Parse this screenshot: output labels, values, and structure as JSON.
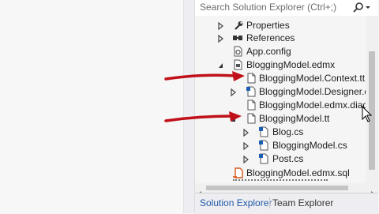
{
  "search": {
    "placeholder": "Search Solution Explorer (Ctrl+;)"
  },
  "tree": {
    "items": [
      {
        "label": "Properties"
      },
      {
        "label": "References"
      },
      {
        "label": "App.config"
      },
      {
        "label": "BloggingModel.edmx"
      },
      {
        "label": "BloggingModel.Context.tt"
      },
      {
        "label": "BloggingModel.Designer.cs"
      },
      {
        "label": "BloggingModel.edmx.diagram"
      },
      {
        "label": "BloggingModel.tt"
      },
      {
        "label": "Blog.cs"
      },
      {
        "label": "BloggingModel.cs"
      },
      {
        "label": "Post.cs"
      },
      {
        "label": "BloggingModel.edmx.sql"
      }
    ]
  },
  "tabs": [
    {
      "label": "Solution Explorer",
      "active": true
    },
    {
      "label": "Team Explorer",
      "active": false
    }
  ],
  "colors": {
    "arrow": "#c0111a",
    "active_tab": "#1e5aa8",
    "cs_icon": "#1a5fb4",
    "sql_icon": "#d9581c"
  }
}
